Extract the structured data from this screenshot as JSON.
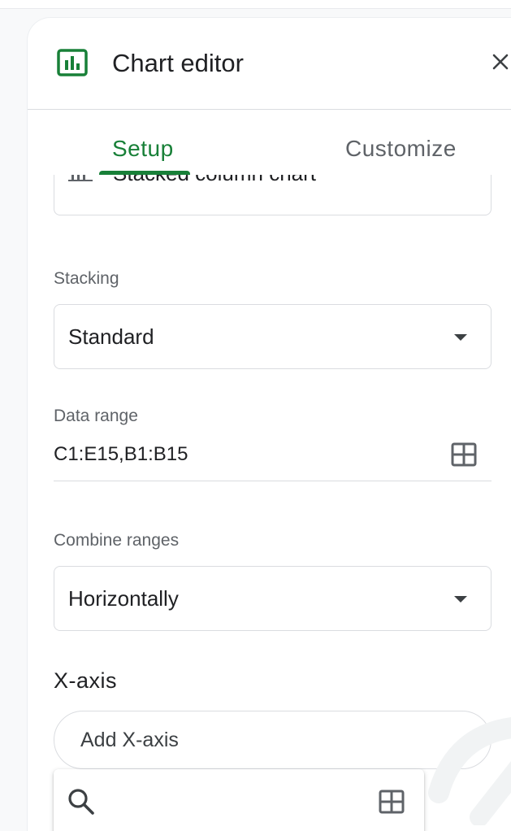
{
  "panel": {
    "title": "Chart editor"
  },
  "tabs": [
    {
      "label": "Setup",
      "active": true
    },
    {
      "label": "Customize",
      "active": false
    }
  ],
  "chart_type": {
    "value": "Stacked column chart"
  },
  "stacking": {
    "label": "Stacking",
    "value": "Standard"
  },
  "data_range": {
    "label": "Data range",
    "value": "C1:E15,B1:B15"
  },
  "combine_ranges": {
    "label": "Combine ranges",
    "value": "Horizontally"
  },
  "x_axis": {
    "title": "X-axis",
    "add_button": "Add X-axis"
  },
  "colors": {
    "accent": "#188038",
    "text": "#202124",
    "muted": "#5f6368",
    "border": "#dadce0"
  },
  "icons": [
    "chart-icon",
    "close-icon",
    "grid-icon",
    "search-icon",
    "chevron-down-icon"
  ]
}
